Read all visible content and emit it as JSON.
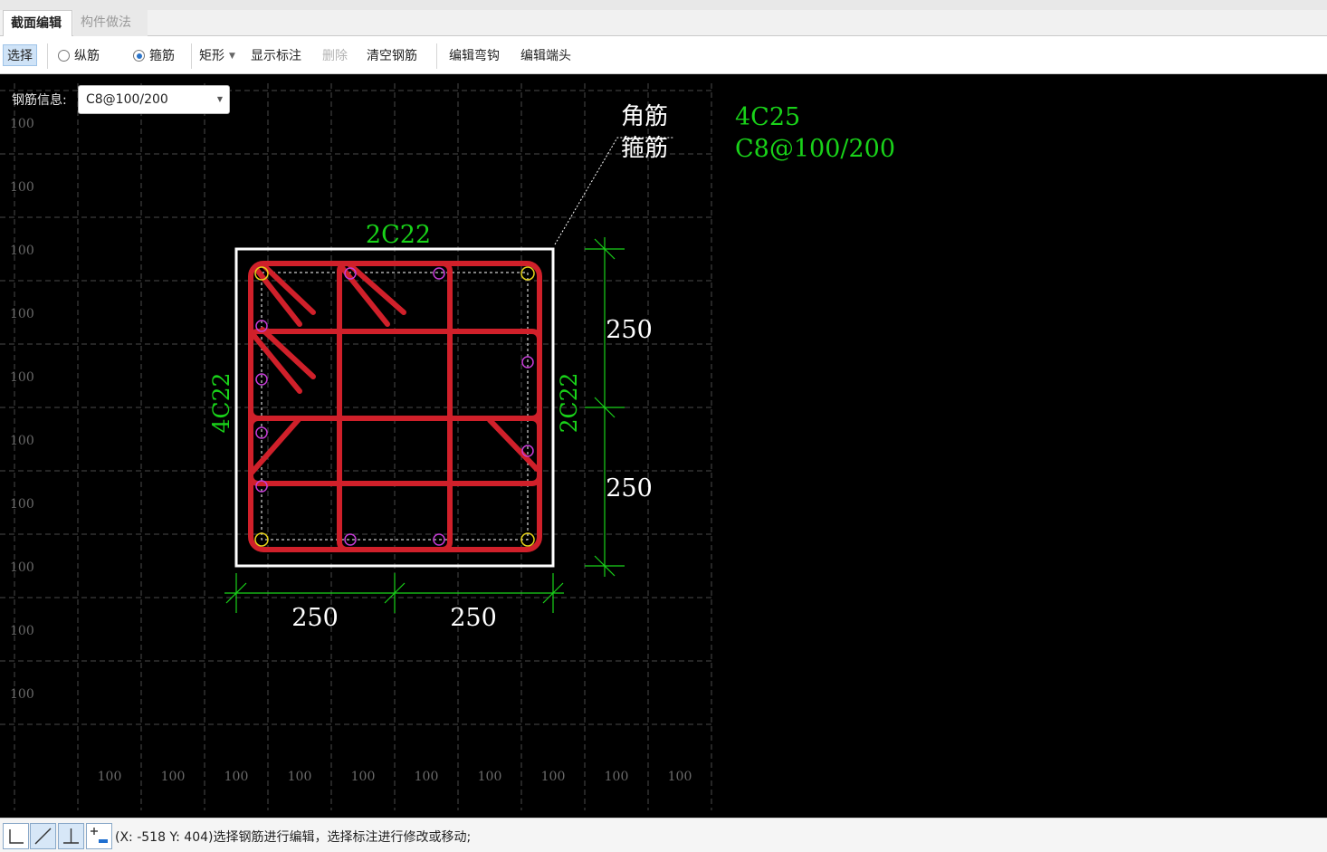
{
  "tabs": [
    {
      "label": "截面编辑",
      "active": true
    },
    {
      "label": "构件做法",
      "active": false
    }
  ],
  "toolbar": {
    "select_label": "选择",
    "longitudinal_label": "纵筋",
    "stirrup_label": "箍筋",
    "shape_label": "矩形",
    "show_annotation_label": "显示标注",
    "delete_label": "删除",
    "clear_rebar_label": "清空钢筋",
    "edit_hook_label": "编辑弯钩",
    "edit_end_label": "编辑端头",
    "selected_radio": "箍筋"
  },
  "rebar_info": {
    "label": "钢筋信息:",
    "value": "C8@100/200"
  },
  "grid": {
    "left_labels": [
      "100",
      "100",
      "100",
      "100",
      "100",
      "100",
      "100",
      "100",
      "100",
      "100"
    ],
    "bottom_labels": [
      "100",
      "100",
      "100",
      "100",
      "100",
      "100",
      "100",
      "100",
      "100",
      "100"
    ]
  },
  "drawing": {
    "top_rebar": "2C22",
    "left_rebar": "4C22",
    "right_rebar": "2C22",
    "dim_right_top": "250",
    "dim_right_bottom": "250",
    "dim_bottom_left": "250",
    "dim_bottom_right": "250",
    "leader_line1": "角筋",
    "leader_line2": "箍筋",
    "corner_rebar": "4C25",
    "stirrup_spec": "C8@100/200"
  },
  "colors": {
    "rebar_red": "#d0202a",
    "annotation_green": "#19d219",
    "grid": "#4a4a4a",
    "outline": "#ffffff",
    "corner_marker": "#e6d21a",
    "side_marker": "#c63cd6"
  },
  "status": {
    "text": "(X: -518 Y: 404)选择钢筋进行编辑，选择标注进行修改或移动;"
  }
}
